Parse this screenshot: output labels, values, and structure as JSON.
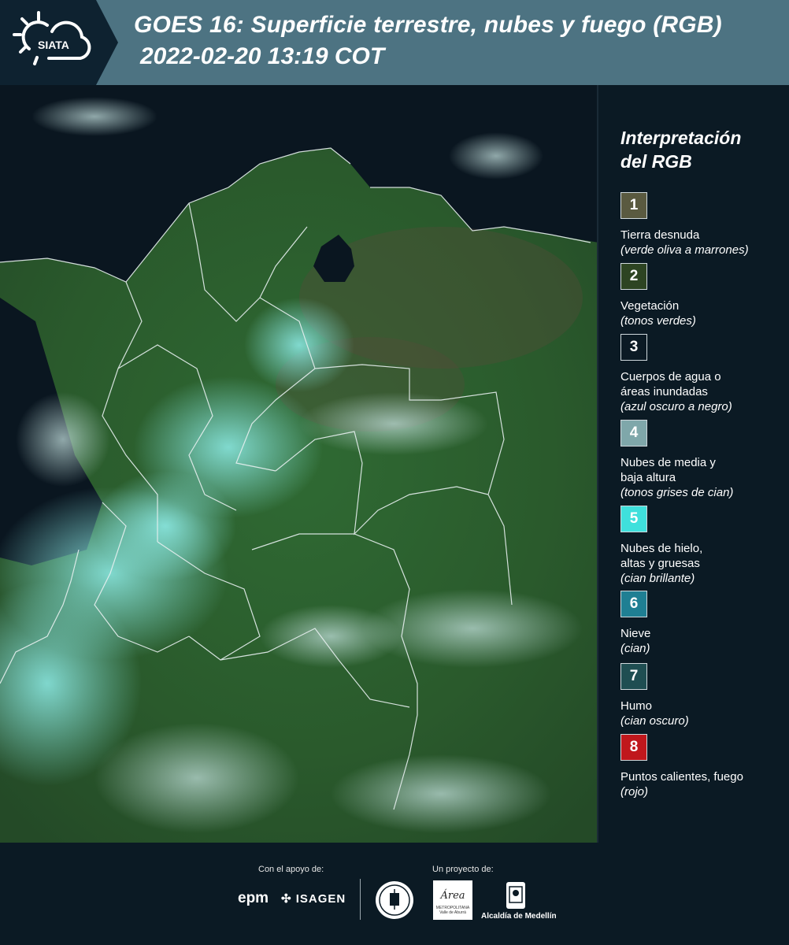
{
  "header": {
    "logo_text": "SIATA",
    "title": "GOES 16: Superficie terrestre, nubes y fuego (RGB)",
    "datetime": "2022-02-20 13:19 COT"
  },
  "legend": {
    "title_line1": "Interpretación",
    "title_line2": "del RGB",
    "items": [
      {
        "number": "1",
        "color": "#5a5a40",
        "label": "Tierra desnuda",
        "label2": "",
        "sub": "(verde oliva a marrones)"
      },
      {
        "number": "2",
        "color": "#2d4422",
        "label": "Vegetación",
        "label2": "",
        "sub": "(tonos verdes)"
      },
      {
        "number": "3",
        "color": "#0b1a24",
        "label": "Cuerpos de agua o",
        "label2": "áreas inundadas",
        "sub": "(azul oscuro a negro)"
      },
      {
        "number": "4",
        "color": "#7fa7aa",
        "label": "Nubes de media y",
        "label2": "baja altura",
        "sub": "(tonos grises de cian)"
      },
      {
        "number": "5",
        "color": "#3fe0dc",
        "label": "Nubes de hielo,",
        "label2": "altas y gruesas",
        "sub": "(cian brillante)"
      },
      {
        "number": "6",
        "color": "#1f7f93",
        "label": "Nieve",
        "label2": "",
        "sub": "(cian)"
      },
      {
        "number": "7",
        "color": "#1f4e52",
        "label": "Humo",
        "label2": "",
        "sub": "(cian oscuro)"
      },
      {
        "number": "8",
        "color": "#c0171c",
        "label": "Puntos calientes, fuego",
        "label2": "",
        "sub": "(rojo)"
      }
    ]
  },
  "footer": {
    "support_label": "Con el apoyo de:",
    "project_label": "Un proyecto de:",
    "epm": "epm",
    "isagen": "ISAGEN",
    "area_logo": "Área",
    "area_small": "METROPOLITANA Valle de Aburrá",
    "alcaldia": "Alcaldía de Medellín"
  }
}
